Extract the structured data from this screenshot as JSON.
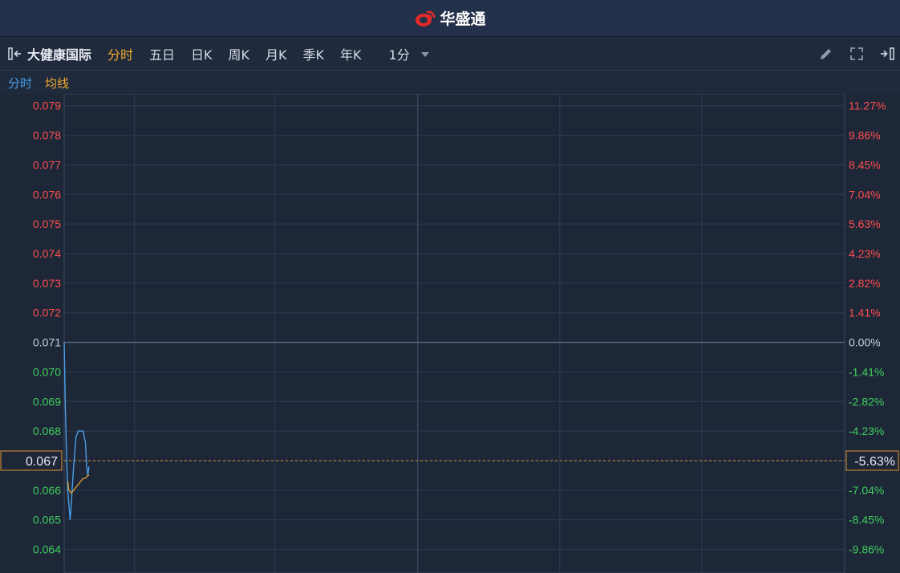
{
  "app": {
    "brand_name": "华盛通"
  },
  "toolbar": {
    "stock_name": "大健康国际",
    "periods": [
      "分时",
      "五日",
      "日K",
      "周K",
      "月K",
      "季K",
      "年K"
    ],
    "active_period": "分时",
    "interval": "1分",
    "icons": [
      "collapse-left-icon",
      "pencil-icon",
      "fullscreen-icon",
      "collapse-right-icon"
    ]
  },
  "legend": {
    "time_label": "分时",
    "avg_label": "均线"
  },
  "colors": {
    "background": "#1d2738",
    "grid": "#2e3b52",
    "up": "#ff4d4d",
    "down": "#3fd05b",
    "flat": "#c9d1dd",
    "price_line": "#4a9ee8",
    "avg_line": "#f0a92e",
    "current": "#e0962a"
  },
  "chart_data": {
    "type": "line",
    "title": "",
    "ylim": [
      0.0632,
      0.0794
    ],
    "prev_close": 0.071,
    "current_price": 0.067,
    "current_price_label": "0.067",
    "current_change_label": "-5.63%",
    "y_ticks": [
      "0.079",
      "0.078",
      "0.077",
      "0.076",
      "0.075",
      "0.074",
      "0.073",
      "0.072",
      "0.071",
      "0.070",
      "0.069",
      "0.068",
      "0.067",
      "0.066",
      "0.065",
      "0.064"
    ],
    "pct_ticks": [
      "11.27%",
      "9.86%",
      "8.45%",
      "7.04%",
      "5.63%",
      "4.23%",
      "2.82%",
      "1.41%",
      "0.00%",
      "-1.41%",
      "-2.82%",
      "-4.23%",
      "-5.63%",
      "-7.04%",
      "-8.45%",
      "-9.86%"
    ],
    "series": [
      {
        "x": [
          0,
          0,
          0.5,
          1,
          1.5,
          2,
          2.5,
          3,
          3.5,
          4,
          5,
          6,
          7,
          8,
          9,
          9.5,
          10,
          10.5
        ],
        "values": [
          0.071,
          0.071,
          0.0688,
          0.0672,
          0.066,
          0.0655,
          0.065,
          0.0655,
          0.0662,
          0.0668,
          0.0678,
          0.068,
          0.068,
          0.068,
          0.0676,
          0.0668,
          0.0665,
          0.0668
        ]
      },
      {
        "x": [
          1.5,
          2,
          3,
          4,
          5,
          6,
          7,
          8,
          9,
          10,
          10.5
        ],
        "values": [
          0.0663,
          0.066,
          0.0659,
          0.066,
          0.0661,
          0.0662,
          0.0663,
          0.0664,
          0.0664,
          0.0665,
          0.0665
        ]
      }
    ]
  }
}
